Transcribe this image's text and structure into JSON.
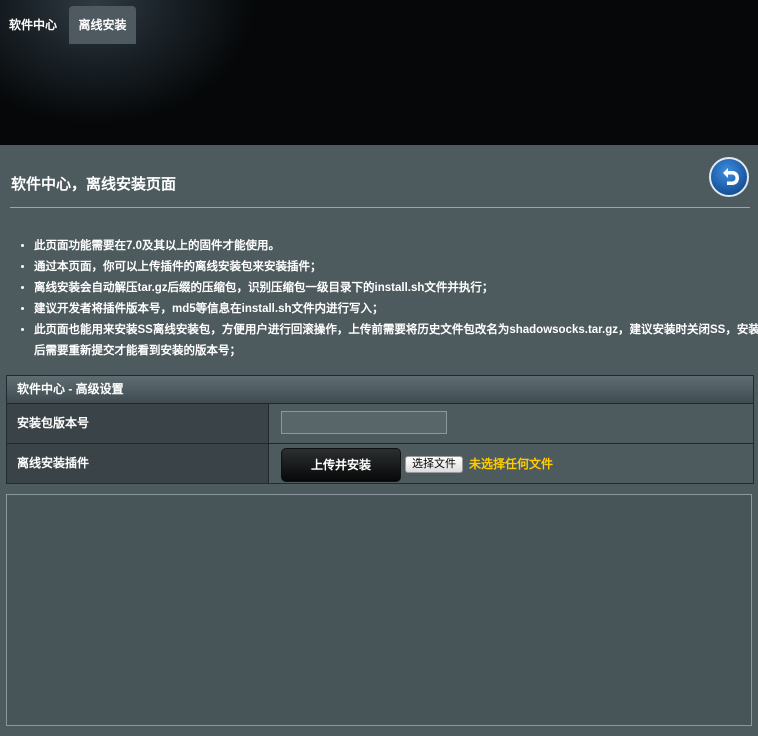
{
  "tabs": [
    {
      "label": "软件中心",
      "active": false
    },
    {
      "label": "离线安装",
      "active": true
    }
  ],
  "page": {
    "title": "软件中心，离线安装页面",
    "back_icon": "return-arrow-icon"
  },
  "notes": [
    "此页面功能需要在7.0及其以上的固件才能使用。",
    "通过本页面，你可以上传插件的离线安装包来安装插件；",
    "离线安装会自动解压tar.gz后缀的压缩包，识别压缩包一级目录下的install.sh文件并执行；",
    "建议开发者将插件版本号，md5等信息在install.sh文件内进行写入；",
    "此页面也能用来安装SS离线安装包，方便用户进行回滚操作，上传前需要将历史文件包改名为shadowsocks.tar.gz，建议安装时关闭SS，安装后需要重新提交才能看到安装的版本号；"
  ],
  "settings": {
    "header": "软件中心 - 高级设置",
    "version_label": "安装包版本号",
    "version_value": "",
    "plugin_label": "离线安装插件",
    "upload_button": "上传并安装",
    "choose_file_button": "选择文件",
    "no_file_text": "未选择任何文件"
  },
  "log": {
    "value": ""
  },
  "colors": {
    "accent_warning": "#ffcc00",
    "panel_bg": "#4d5a5e"
  }
}
